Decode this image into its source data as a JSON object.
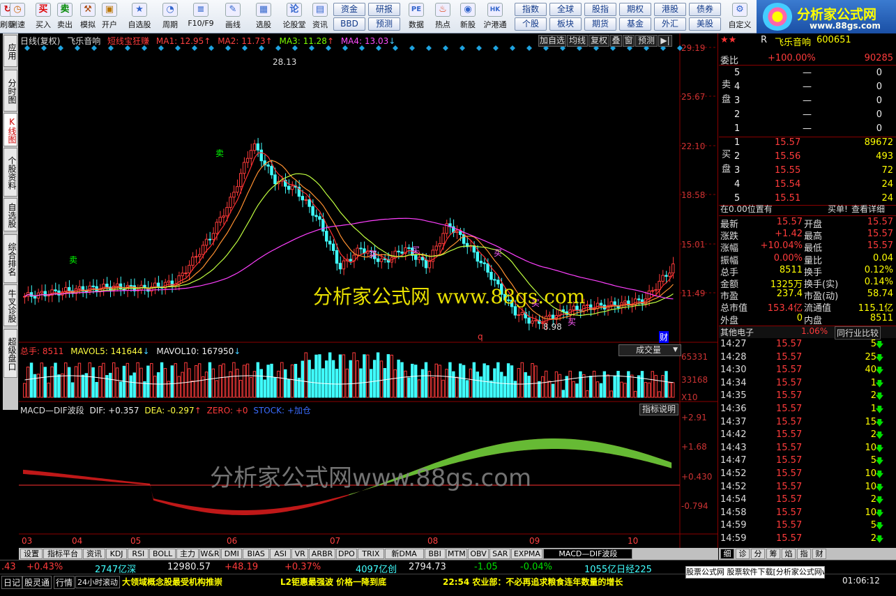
{
  "toolbar": {
    "items": [
      {
        "label": "刷新",
        "icon": "refresh-icon"
      },
      {
        "label": "测速",
        "icon": "clock-icon"
      },
      {
        "label": "买入",
        "icon": "buy-icon"
      },
      {
        "label": "卖出",
        "icon": "sell-icon"
      },
      {
        "label": "模拟",
        "icon": "hammer-icon"
      },
      {
        "label": "开户",
        "icon": "lock-icon"
      },
      {
        "label": "自选股",
        "icon": "star-icon"
      },
      {
        "label": "周期",
        "icon": "clock-icon"
      },
      {
        "label": "F10/F9",
        "icon": "f10-icon"
      },
      {
        "label": "画线",
        "icon": "pencil-icon"
      },
      {
        "label": "选股",
        "icon": "screen-icon"
      },
      {
        "label": "论股堂",
        "icon": "chat-icon"
      },
      {
        "label": "资讯",
        "icon": "news-icon"
      },
      {
        "label": "数据",
        "icon": "pe-icon"
      },
      {
        "label": "热点",
        "icon": "hot-icon"
      },
      {
        "label": "新股",
        "icon": "newstock-icon"
      },
      {
        "label": "沪港通",
        "icon": "hk-icon"
      },
      {
        "label": "自定义",
        "icon": "custom-icon"
      }
    ],
    "small_buttons": [
      "资金",
      "研报",
      "BBD",
      "预测",
      "指数",
      "全球",
      "股指",
      "期权",
      "港股",
      "债券",
      "个股",
      "板块",
      "期货",
      "基金",
      "外汇",
      "美股"
    ]
  },
  "logo": {
    "title": "分析家公式网",
    "url": "www.88gs.com"
  },
  "left_tabs": [
    "应用",
    "分时图",
    "K线图",
    "个股资料",
    "自选股",
    "综合排名",
    "牛叉诊股",
    "超级盘口"
  ],
  "chart": {
    "header": {
      "period": "日线(复权)",
      "name": "飞乐音响",
      "indicator": "短线宝狂赚",
      "ma1": "MA1: 12.95",
      "ma2": "MA2: 11.73",
      "ma3": "MA3: 11.28",
      "ma4": "MA4: 13.03"
    },
    "right_buttons": [
      "加自选",
      "均线",
      "复权",
      "叠",
      "窗",
      "预测"
    ],
    "price_axis": [
      "29.19",
      "25.67",
      "22.10",
      "18.58",
      "15.01",
      "11.49"
    ],
    "high_label": "28.13",
    "low_label": "8.98",
    "buy_marks": [
      "买",
      "买",
      "买",
      "买",
      "买"
    ],
    "sell_marks": [
      "卖",
      "卖"
    ],
    "finance_marker": "财",
    "q_marker": "q",
    "watermark": "分析家公式网 www.88gs.com",
    "volume": {
      "label": "总手: 8511",
      "mavol5": "MAVOL5: 141644",
      "mavol10": "MAVOL10: 167950",
      "dropdown": "成交量",
      "axis": [
        "65331",
        "33168",
        "X10"
      ]
    },
    "macd": {
      "label": "MACD—DIF波段",
      "dif": "DIF: +0.357",
      "dea": "DEA: -0.297",
      "zero": "ZERO: +0",
      "stock": "STOCK: +加仓",
      "help": "指标说明",
      "axis": [
        "+2.91",
        "+1.68",
        "+0.430",
        "-0.794"
      ],
      "watermark": "分析家公式网www.88gs.com"
    },
    "months": [
      "03",
      "04",
      "05",
      "06",
      "07",
      "08",
      "09",
      "10"
    ]
  },
  "bottom_tabs": [
    "设置",
    "指标平台",
    "资讯",
    "KDJ",
    "RSI",
    "BOLL",
    "主力",
    "W&R",
    "DMI",
    "BIAS",
    "ASI",
    "VR",
    "ARBR",
    "DPO",
    "TRIX",
    "新DMA",
    "BBI",
    "MTM",
    "OBV",
    "SAR",
    "EXPMA",
    "MACD—DIF波段"
  ],
  "right_panel": {
    "code_bar": {
      "prefix": "R",
      "name": "飞乐音响",
      "code": "600651"
    },
    "weibi": {
      "label": "委比",
      "value": "+100.00%",
      "count": "90285"
    },
    "sell_label": "卖盘",
    "buy_label": "买盘",
    "sell": [
      {
        "n": "5",
        "p": "—",
        "v": "0"
      },
      {
        "n": "4",
        "p": "—",
        "v": "0"
      },
      {
        "n": "3",
        "p": "—",
        "v": "0"
      },
      {
        "n": "2",
        "p": "—",
        "v": "0"
      },
      {
        "n": "1",
        "p": "—",
        "v": "0"
      }
    ],
    "buy": [
      {
        "n": "1",
        "p": "15.57",
        "v": "89672"
      },
      {
        "n": "2",
        "p": "15.56",
        "v": "493"
      },
      {
        "n": "3",
        "p": "15.55",
        "v": "72"
      },
      {
        "n": "4",
        "p": "15.54",
        "v": "24"
      },
      {
        "n": "5",
        "p": "15.51",
        "v": "24"
      }
    ],
    "position": "在0.00位置有",
    "buy_link": "买单!",
    "detail_link": "查看详细",
    "stats": [
      {
        "l1": "最新",
        "v1": "15.57",
        "l2": "开盘",
        "v2": "15.57"
      },
      {
        "l1": "涨跌",
        "v1": "+1.42",
        "l2": "最高",
        "v2": "15.57"
      },
      {
        "l1": "涨幅",
        "v1": "+10.04%",
        "l2": "最低",
        "v2": "15.57"
      },
      {
        "l1": "振幅",
        "v1": "0.00%",
        "l2": "量比",
        "v2": "0.04"
      },
      {
        "l1": "总手",
        "v1": "8511",
        "l2": "换手",
        "v2": "0.12%"
      },
      {
        "l1": "金额",
        "v1": "1325万",
        "l2": "换手(实)",
        "v2": "0.14%"
      },
      {
        "l1": "市盈",
        "v1": "237.4",
        "l2": "市盈(动)",
        "v2": "58.74"
      },
      {
        "l1": "总市值",
        "v1": "153.4亿",
        "l2": "流通值",
        "v2": "115.1亿"
      },
      {
        "l1": "外盘",
        "v1": "0",
        "l2": "内盘",
        "v2": "8511"
      }
    ],
    "industry": {
      "name": "其他电子",
      "change": "1.06%",
      "compare": "同行业比较"
    },
    "ticks": [
      {
        "t": "14:27",
        "p": "15.57",
        "v": "5"
      },
      {
        "t": "14:28",
        "p": "15.57",
        "v": "25"
      },
      {
        "t": "14:30",
        "p": "15.57",
        "v": "40"
      },
      {
        "t": "14:34",
        "p": "15.57",
        "v": "1"
      },
      {
        "t": "14:35",
        "p": "15.57",
        "v": "2"
      },
      {
        "t": "14:36",
        "p": "15.57",
        "v": "1"
      },
      {
        "t": "14:37",
        "p": "15.57",
        "v": "15"
      },
      {
        "t": "14:42",
        "p": "15.57",
        "v": "2"
      },
      {
        "t": "14:43",
        "p": "15.57",
        "v": "10"
      },
      {
        "t": "14:47",
        "p": "15.57",
        "v": "5"
      },
      {
        "t": "14:52",
        "p": "15.57",
        "v": "10"
      },
      {
        "t": "14:52",
        "p": "15.57",
        "v": "10"
      },
      {
        "t": "14:54",
        "p": "15.57",
        "v": "2"
      },
      {
        "t": "14:58",
        "p": "15.57",
        "v": "10"
      },
      {
        "t": "14:59",
        "p": "15.57",
        "v": "5"
      },
      {
        "t": "14:59",
        "p": "15.57",
        "v": "2"
      }
    ],
    "bottom_tabs": [
      "细",
      "诊",
      "分",
      "筹",
      "焰",
      "指",
      "财"
    ]
  },
  "status": {
    "row1": [
      {
        "text": ".43",
        "c": "red"
      },
      {
        "text": "+0.43%",
        "c": "red"
      },
      {
        "text": "2747亿深",
        "c": "cyn"
      },
      {
        "text": "12980.57",
        "c": "wht"
      },
      {
        "text": "+48.19",
        "c": "red"
      },
      {
        "text": "+0.37%",
        "c": "red"
      },
      {
        "text": "4097亿创",
        "c": "cyn"
      },
      {
        "text": "2794.73",
        "c": "wht"
      },
      {
        "text": "-1.05",
        "c": "grn"
      },
      {
        "text": "-0.04%",
        "c": "grn"
      },
      {
        "text": "1055亿日经225",
        "c": "cyn"
      }
    ],
    "row2_left": [
      "日记",
      "股灵通",
      "行情",
      "24小时滚动"
    ],
    "ticker1": "大领域概念股最受机构推崇",
    "ticker2": "L2钜惠最强波 价格一降到底",
    "ticker3": "22:54 农业部：不必再追求粮食连年数量的增长",
    "banner": "股票公式网 股票软件下载[分析家公式网www.88gs.com]",
    "time": "01:06:12"
  }
}
